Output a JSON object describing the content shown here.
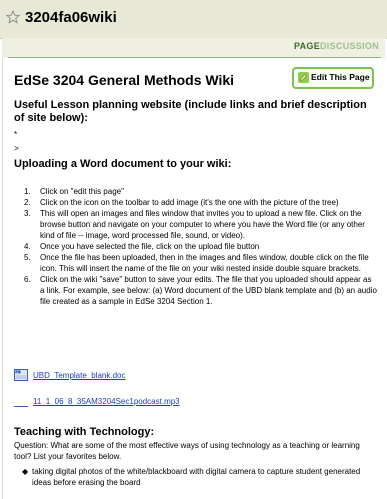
{
  "header": {
    "wiki_name": "3204fa06wiki",
    "star_icon": "star-icon"
  },
  "tabs": [
    {
      "label": "PAGE"
    },
    {
      "label": "DISCUSSION"
    }
  ],
  "page": {
    "title": "EdSe 3204 General Methods Wiki",
    "edit_button": "Edit This Page",
    "section1": {
      "heading": "Useful Lesson planning website (include links and brief description of site below):",
      "lines": [
        "*",
        ">"
      ]
    },
    "section2": {
      "heading": "Uploading a Word document to your wiki:",
      "steps": [
        "Click on \"edit this page\"",
        "Click on the icon on the toolbar to add image (it's the one with the picture of the tree)",
        "This will open an images and files window that invites you to upload a new file. Click on the browse button and navigate on your computer to where you have the Word file (or any other kind of file -- image, word processed file, sound, or video).",
        "Once you have selected the file, click on the upload file button",
        "Once the file has been uploaded, then in the images and files window, double click on the file icon. This will insert the name of the file on your wiki nested inside double square brackets.",
        "Click on the wiki \"save\" button to save your edits. The file that you uploaded should appear as a link. For example, see below: (a) Word document of the UBD blank template and (b) an audio file created as a sample in EdSe 3204 Section 1."
      ],
      "files": [
        {
          "name": "UBD_Template_blank.doc",
          "icon": "word-doc-icon"
        },
        {
          "name": "11_1_06_8_35AM3204Sec1podcast.mp3",
          "icon": "audio-file-icon"
        }
      ]
    },
    "section3": {
      "heading": "Teaching with Technology:",
      "question": "Question: What are some of the most effective ways of using technology as a teaching or learning tool? List your favorites below.",
      "bullets": [
        "taking digital photos of the white/blackboard with digital camera to capture student generated ideas before erasing the board"
      ]
    }
  }
}
